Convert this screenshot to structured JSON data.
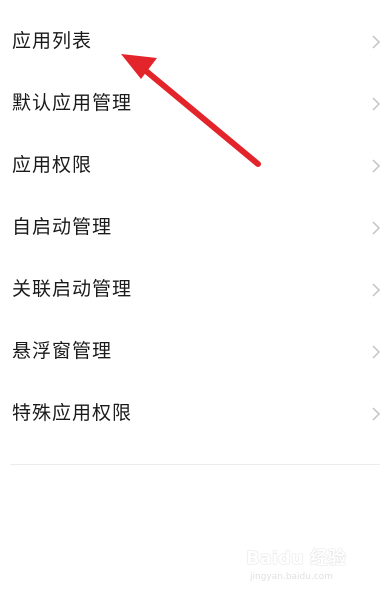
{
  "settings": {
    "items": [
      {
        "label": "应用列表"
      },
      {
        "label": "默认应用管理"
      },
      {
        "label": "应用权限"
      },
      {
        "label": "自启动管理"
      },
      {
        "label": "关联启动管理"
      },
      {
        "label": "悬浮窗管理"
      },
      {
        "label": "特殊应用权限"
      }
    ],
    "chevron_icon": "chevron-right-icon"
  },
  "annotation": {
    "color": "#e3252b"
  },
  "watermark": {
    "brand": "Baidu 经验",
    "url": "jingyan.baidu.com"
  }
}
